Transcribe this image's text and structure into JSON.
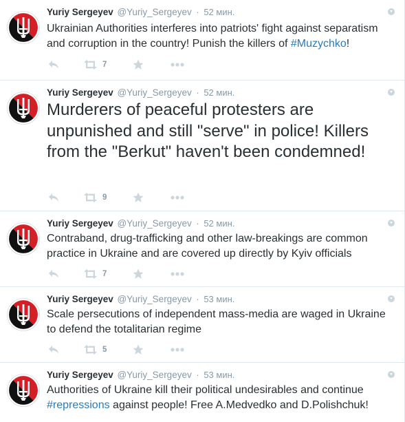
{
  "colors": {
    "link": "#2b7bb9",
    "muted": "#8899a6",
    "icon": "#ccd6dd",
    "border": "#e1e8ed"
  },
  "avatar_icon": "black-red-trident-avatar",
  "tweets": [
    {
      "name": "Yuriy Sergeyev",
      "handle": "@Yuriy_Sergeyev",
      "dot": "·",
      "time": "52 мин.",
      "text_parts": [
        "Ukrainian Authorities interferes into patriots' fight against separatism and corruption in the country! Punish the killers of ",
        "#Muzychko",
        "!"
      ],
      "retweets": "7"
    },
    {
      "name": "Yuriy Sergeyev",
      "handle": "@Yuriy_Sergeyev",
      "dot": "·",
      "time": "52 мин.",
      "text": "Murderers of peaceful protesters are unpunished and still \"serve\" in police! Killers from the \"Berkut\" haven't been condemned!",
      "retweets": "9"
    },
    {
      "name": "Yuriy Sergeyev",
      "handle": "@Yuriy_Sergeyev",
      "dot": "·",
      "time": "52 мин.",
      "text": "Contraband, drug-trafficking and other law-breakings are common practice in Ukraine and are covered up directly by Kyiv officials",
      "retweets": "7"
    },
    {
      "name": "Yuriy Sergeyev",
      "handle": "@Yuriy_Sergeyev",
      "dot": "·",
      "time": "53 мин.",
      "text": "Scale persecutions of independent mass-media are waged in Ukraine to defend the totalitarian regime",
      "retweets": "5"
    },
    {
      "name": "Yuriy Sergeyev",
      "handle": "@Yuriy_Sergeyev",
      "dot": "·",
      "time": "53 мин.",
      "text_parts": [
        "Authorities of Ukraine kill their political undesirables and continue ",
        "#repressions",
        " against people! Free A.Medvedko and D.Polishchuk!"
      ]
    }
  ]
}
